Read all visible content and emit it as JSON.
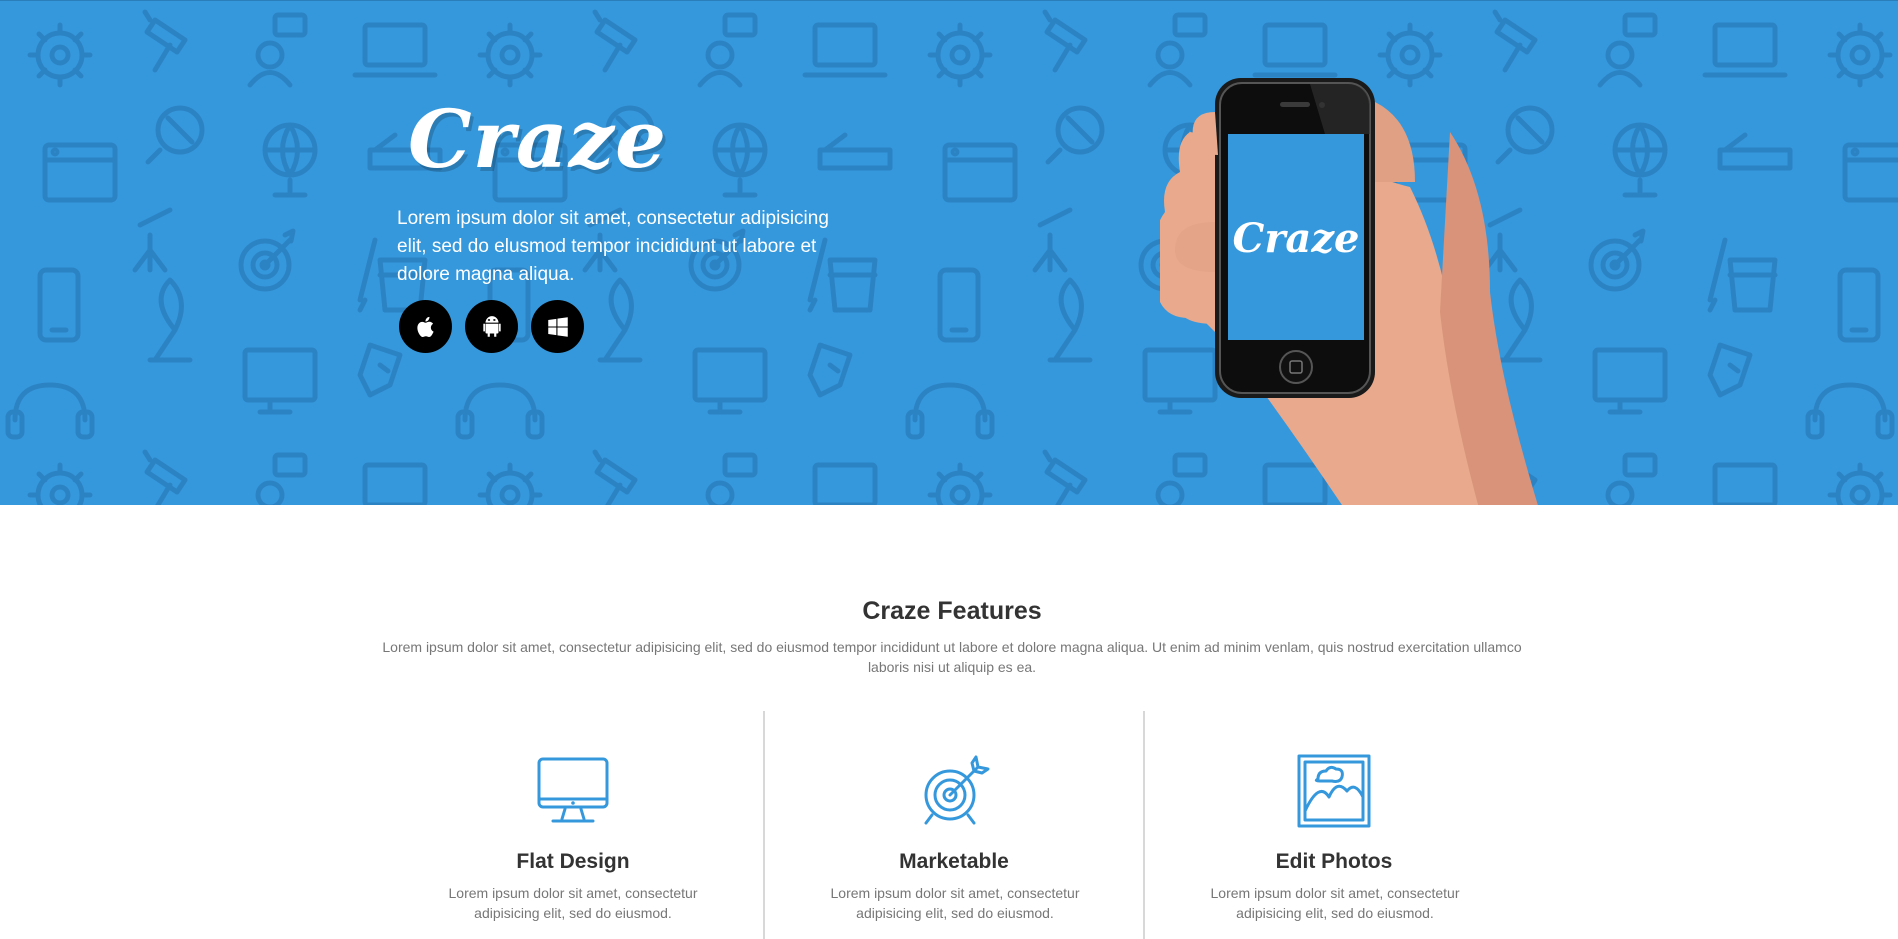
{
  "hero": {
    "logo_text": "Craze",
    "tagline": "Lorem ipsum dolor sit amet, consectetur adipisicing elit, sed do elusmod tempor incididunt ut labore et dolore magna aliqua.",
    "phone_logo_text": "Craze",
    "store_buttons": [
      {
        "icon": "apple-icon"
      },
      {
        "icon": "android-icon"
      },
      {
        "icon": "windows-icon"
      }
    ],
    "background_color": "#3598dc"
  },
  "features": {
    "title": "Craze Features",
    "subtitle": "Lorem ipsum dolor sit amet, consectetur adipisicing elit, sed do eiusmod tempor incididunt ut labore et dolore magna aliqua. Ut enim ad minim venlam, quis nostrud exercitation ullamco laboris nisi ut aliquip es ea.",
    "items": [
      {
        "icon": "monitor-icon",
        "title": "Flat Design",
        "text": "Lorem ipsum dolor sit amet, consectetur adipisicing elit, sed do eiusmod."
      },
      {
        "icon": "target-icon",
        "title": "Marketable",
        "text": "Lorem ipsum dolor sit amet, consectetur adipisicing elit, sed do eiusmod."
      },
      {
        "icon": "photo-icon",
        "title": "Edit Photos",
        "text": "Lorem ipsum dolor sit amet, consectetur adipisicing elit, sed do eiusmod."
      }
    ]
  },
  "colors": {
    "accent": "#3598dc",
    "heading": "#333333",
    "body_text": "#777777"
  }
}
